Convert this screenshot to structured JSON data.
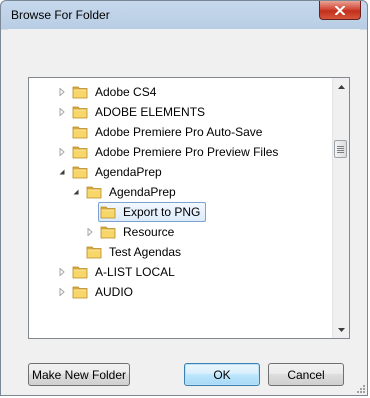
{
  "window": {
    "title": "Browse For Folder"
  },
  "tree": {
    "items": [
      {
        "label": "Adobe CS4",
        "depth": 0,
        "expander": "collapsed"
      },
      {
        "label": "ADOBE ELEMENTS",
        "depth": 0,
        "expander": "collapsed"
      },
      {
        "label": "Adobe Premiere Pro Auto-Save",
        "depth": 0,
        "expander": "none"
      },
      {
        "label": "Adobe Premiere Pro Preview Files",
        "depth": 0,
        "expander": "collapsed"
      },
      {
        "label": "AgendaPrep",
        "depth": 0,
        "expander": "expanded"
      },
      {
        "label": "AgendaPrep",
        "depth": 1,
        "expander": "expanded"
      },
      {
        "label": "Export to PNG",
        "depth": 2,
        "expander": "none",
        "selected": true
      },
      {
        "label": "Resource",
        "depth": 2,
        "expander": "collapsed"
      },
      {
        "label": "Test Agendas",
        "depth": 1,
        "expander": "none"
      },
      {
        "label": "A-LIST LOCAL",
        "depth": 0,
        "expander": "collapsed"
      },
      {
        "label": "AUDIO",
        "depth": 0,
        "expander": "collapsed"
      }
    ]
  },
  "buttons": {
    "make_new_folder": "Make New Folder",
    "ok": "OK",
    "cancel": "Cancel"
  },
  "colors": {
    "selection_border": "#7da2ce",
    "default_button_border": "#3c7fb1",
    "close_button": "#c0301c"
  }
}
